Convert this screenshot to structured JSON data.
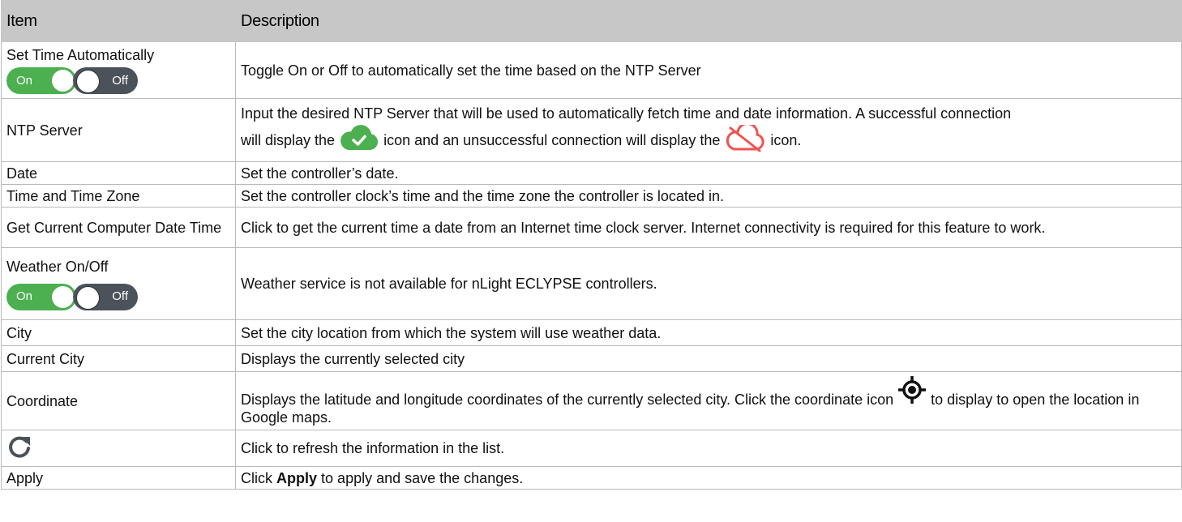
{
  "headers": {
    "item": "Item",
    "description": "Description"
  },
  "rows": [
    {
      "item": "Set Time Automatically",
      "toggle_on": "On",
      "toggle_off": "Off",
      "desc": "Toggle On or Off to automatically set the time based on the NTP Server"
    },
    {
      "item": "NTP Server",
      "desc_line1": "Input the desired NTP Server that will be used to automatically fetch time and date information. A successful connection",
      "desc_a": "will display the",
      "desc_b": "icon and an unsuccessful connection will display the",
      "desc_c": "icon.",
      "icon_success": "cloud-check-icon",
      "icon_fail": "cloud-off-icon"
    },
    {
      "item": "Date",
      "desc": "Set the controller’s date."
    },
    {
      "item": "Time and Time Zone",
      "desc": "Set the controller clock’s time and the time zone the controller is located in."
    },
    {
      "item": "Get Current Computer Date Time",
      "desc": "Click to get the current time a date from an Internet time clock server. Internet connectivity is required for this feature to work."
    },
    {
      "item": "Weather On/Off",
      "toggle_on": "On",
      "toggle_off": "Off",
      "desc": "Weather service is not available for nLight ECLYPSE controllers."
    },
    {
      "item": "City",
      "desc": "Set the city location from which the system will use weather data."
    },
    {
      "item": "Current City",
      "desc": "Displays the currently selected city"
    },
    {
      "item": "Coordinate",
      "desc_a": "Displays the latitude and longitude coordinates of the currently selected city. Click the coordinate icon",
      "desc_b": "to display to open the location in Google maps.",
      "icon": "target-icon"
    },
    {
      "icon": "refresh-icon",
      "desc": "Click to refresh the information in the list."
    },
    {
      "item": "Apply",
      "desc_a": "Click",
      "desc_bold": "Apply",
      "desc_b": "to apply and save the changes."
    }
  ],
  "colors": {
    "header_bg": "#c7c7c7",
    "toggle_on": "#4caf50",
    "toggle_off": "#4b525a",
    "success": "#4caf50",
    "fail": "#ef5350"
  }
}
